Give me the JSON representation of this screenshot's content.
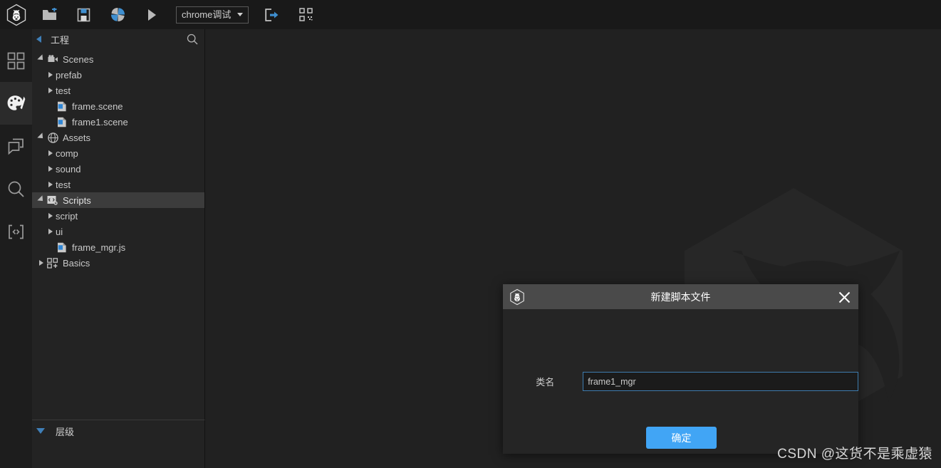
{
  "app": {
    "logo_icon": "cocos-hexagon-logo-icon"
  },
  "toolbar": {
    "buttons": [
      {
        "name": "new-folder-button",
        "icon": "folder-new-icon"
      },
      {
        "name": "save-button",
        "icon": "save-disk-icon"
      },
      {
        "name": "refresh-button",
        "icon": "pinwheel-refresh-icon"
      },
      {
        "name": "play-button",
        "icon": "play-triangle-icon"
      }
    ],
    "device_select": {
      "value": "chrome调试",
      "caret_icon": "chevron-down-icon"
    },
    "right_buttons": [
      {
        "name": "open-external-button",
        "icon": "external-window-icon"
      },
      {
        "name": "qrcode-button",
        "icon": "qr-code-icon"
      }
    ]
  },
  "rail": {
    "items": [
      {
        "name": "sidebar-item-dashboard",
        "icon": "grid-squares-icon",
        "active": false
      },
      {
        "name": "sidebar-item-assets",
        "icon": "palette-icon",
        "active": true
      },
      {
        "name": "sidebar-item-console",
        "icon": "chat-bubbles-icon",
        "active": false
      },
      {
        "name": "sidebar-item-search",
        "icon": "magnifier-icon",
        "active": false
      },
      {
        "name": "sidebar-item-code",
        "icon": "code-brackets-icon",
        "active": false
      }
    ]
  },
  "project": {
    "title": "工程",
    "search_icon": "search-icon",
    "collapse_icon": "triangle-left-icon",
    "tree": [
      {
        "label": "Scenes",
        "depth": 0,
        "twisty": "down",
        "icon": "camera-icon",
        "selected": false
      },
      {
        "label": "prefab",
        "depth": 1,
        "twisty": "right",
        "icon": "none",
        "selected": false
      },
      {
        "label": "test",
        "depth": 1,
        "twisty": "right",
        "icon": "none",
        "selected": false
      },
      {
        "label": "frame.scene",
        "depth": 1,
        "twisty": "none",
        "icon": "scene-file-icon",
        "selected": false
      },
      {
        "label": "frame1.scene",
        "depth": 1,
        "twisty": "none",
        "icon": "scene-file-icon",
        "selected": false
      },
      {
        "label": "Assets",
        "depth": 0,
        "twisty": "down",
        "icon": "globe-icon",
        "selected": false
      },
      {
        "label": "comp",
        "depth": 1,
        "twisty": "right",
        "icon": "none",
        "selected": false
      },
      {
        "label": "sound",
        "depth": 1,
        "twisty": "right",
        "icon": "none",
        "selected": false
      },
      {
        "label": "test",
        "depth": 1,
        "twisty": "right",
        "icon": "none",
        "selected": false
      },
      {
        "label": "Scripts",
        "depth": 0,
        "twisty": "down",
        "icon": "script-folder-icon",
        "selected": true
      },
      {
        "label": "script",
        "depth": 1,
        "twisty": "right",
        "icon": "none",
        "selected": false
      },
      {
        "label": "ui",
        "depth": 1,
        "twisty": "right",
        "icon": "none",
        "selected": false
      },
      {
        "label": "frame_mgr.js",
        "depth": 1,
        "twisty": "none",
        "icon": "script-file-icon",
        "selected": false
      },
      {
        "label": "Basics",
        "depth": 0,
        "twisty": "right",
        "icon": "blocks-icon",
        "selected": false
      }
    ]
  },
  "hierarchy": {
    "title": "层级",
    "collapse_icon": "triangle-down-icon"
  },
  "dialog": {
    "title": "新建脚本文件",
    "logo_icon": "cocos-hexagon-logo-icon",
    "close_icon": "close-x-icon",
    "field_label": "类名",
    "field_value": "frame1_mgr",
    "field_placeholder": "",
    "confirm_label": "确定",
    "accent_color": "#41a5f5",
    "titlebar_color": "#4a4a4a",
    "body_color": "#252525",
    "input_border_color": "#3e7cae"
  },
  "watermark": {
    "text": "CSDN @这货不是乘虚猿"
  },
  "colors": {
    "toolbar_bg": "#191919",
    "rail_bg": "#1d1d1d",
    "panel_bg": "#232323",
    "viewport_bg": "#212121",
    "selection_bg": "#3c3c3c",
    "accent_blue": "#3f7fb8"
  }
}
